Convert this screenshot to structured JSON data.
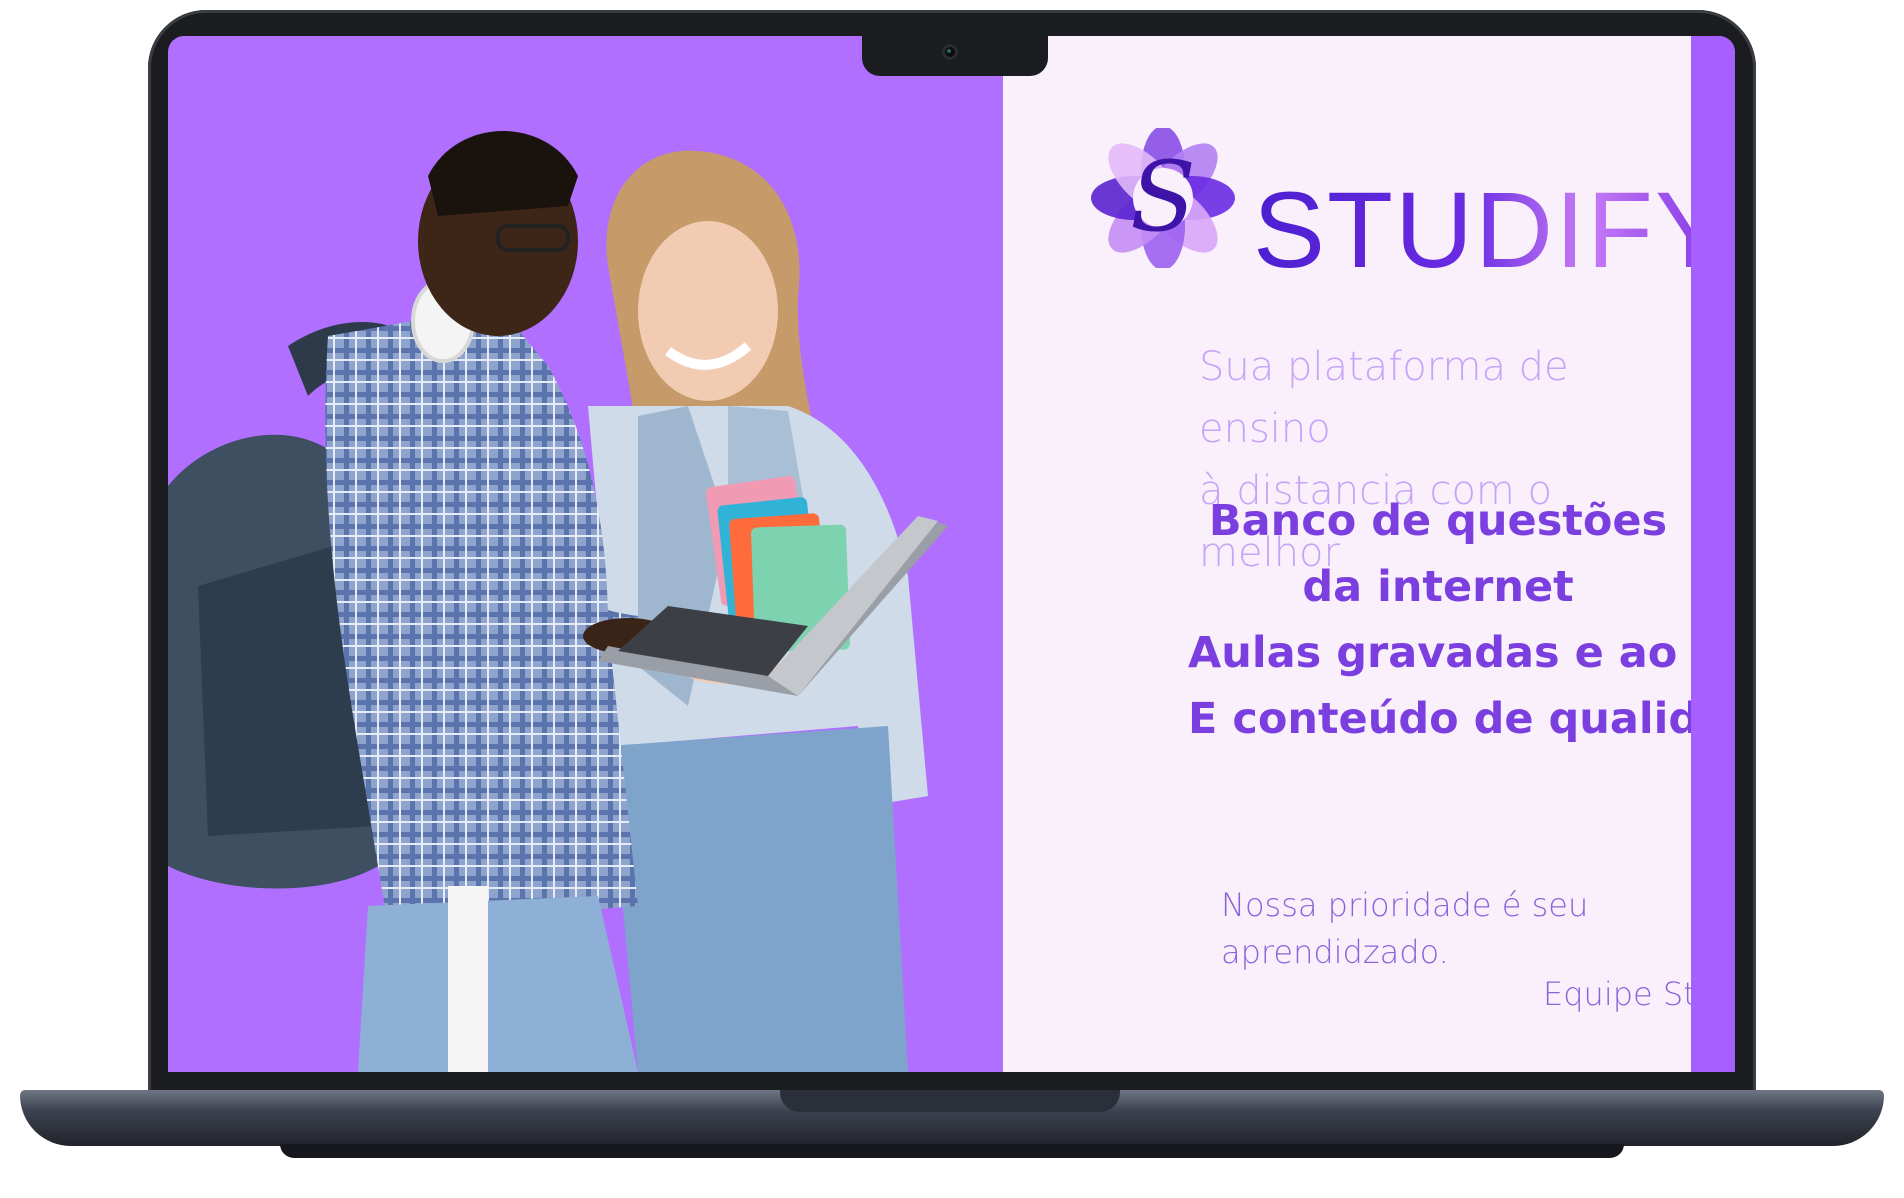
{
  "colors": {
    "screen_background": "#b06fff",
    "panel_background": "#f9f0fb",
    "brand_purple": "#6a2be3",
    "feature_text": "#7b3fe0",
    "tagline_text": "#c6a4f7"
  },
  "logo": {
    "brand_name": "STUDIFY",
    "emblem_letter": "S",
    "icon": "flower-s-logo-icon"
  },
  "photo": {
    "icon": "students-with-laptop-photo"
  },
  "content": {
    "tagline_line1": "Sua plataforma de ensino",
    "tagline_line2": "à distancia com o melhor",
    "features": [
      "Banco de questões",
      "da internet",
      "Aulas gravadas e ao vivo",
      "E conteúdo de qualidade"
    ],
    "note_line1": "Nossa prioridade é seu",
    "note_line2": "aprendidzado.",
    "signature": "Equipe Studify"
  }
}
